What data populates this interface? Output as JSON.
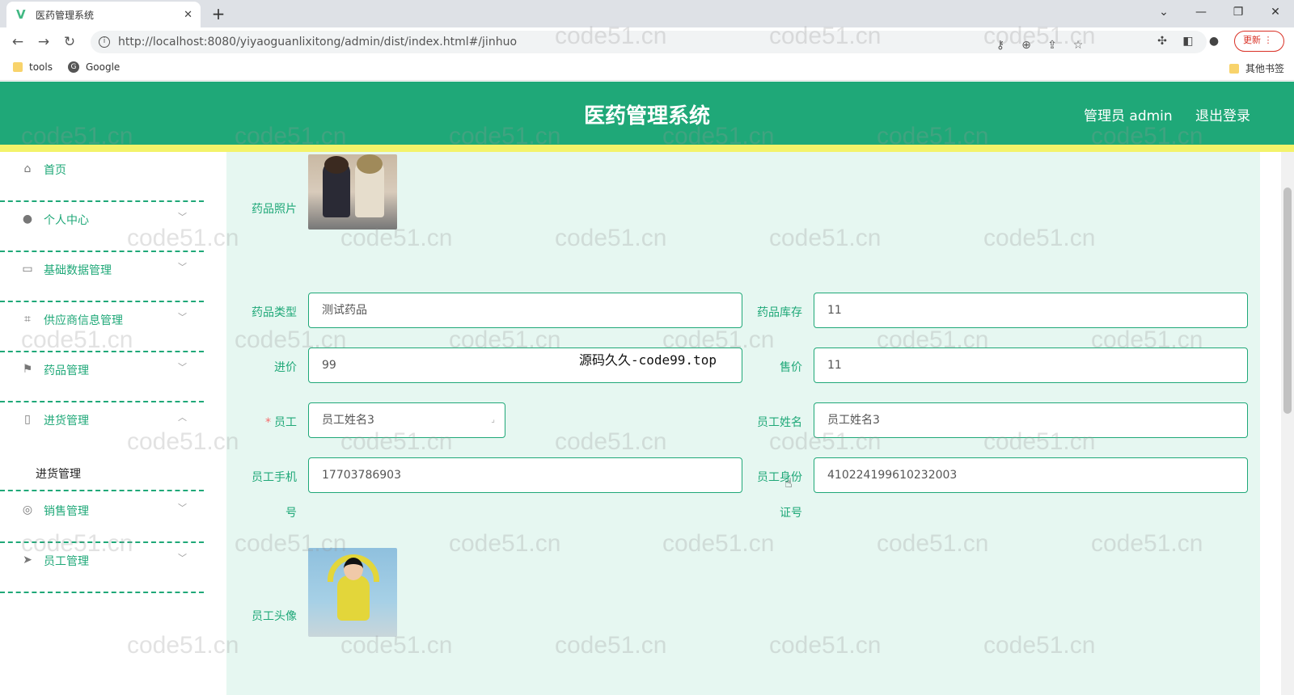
{
  "browser": {
    "tab_title": "医药管理系统",
    "favicon_letter": "V",
    "new_tab": "+",
    "close_tab": "✕",
    "url": "http://localhost:8080/yiyaoguanlixitong/admin/dist/index.html#/jinhuo",
    "update_label": "更新",
    "bookmarks": [
      {
        "label": "tools"
      },
      {
        "label": "Google"
      },
      {
        "label": "其他书签"
      }
    ]
  },
  "header": {
    "title": "医药管理系统",
    "admin_label": "管理员 admin",
    "logout_label": "退出登录",
    "accent": "#1fa878",
    "strip": "#f3f36a"
  },
  "sidebar": {
    "items": [
      {
        "label": "首页",
        "icon": "home-icon"
      },
      {
        "label": "个人中心",
        "icon": "user-icon"
      },
      {
        "label": "基础数据管理",
        "icon": "monitor-icon"
      },
      {
        "label": "供应商信息管理",
        "icon": "crop-icon"
      },
      {
        "label": "药品管理",
        "icon": "flag-icon"
      },
      {
        "label": "进货管理",
        "icon": "phone-icon"
      },
      {
        "label": "销售管理",
        "icon": "circle-icon"
      },
      {
        "label": "员工管理",
        "icon": "send-icon"
      }
    ],
    "submenu_label": "进货管理"
  },
  "form": {
    "drug_photo_label": "药品照片",
    "drug_type_label": "药品类型",
    "drug_type_value": "测试药品",
    "drug_stock_label": "药品库存",
    "drug_stock_value": "11",
    "purchase_price_label": "进价",
    "purchase_price_value": "99",
    "sale_price_label": "售价",
    "sale_price_value": "11",
    "staff_label": "员工",
    "staff_required": "*",
    "staff_select_value": "员工姓名3",
    "staff_name_label": "员工姓名",
    "staff_name_value": "员工姓名3",
    "staff_phone_label_1": "员工手机",
    "staff_phone_label_2": "号",
    "staff_phone_value": "17703786903",
    "staff_id_label_1": "员工身份",
    "staff_id_label_2": "证号",
    "staff_id_value": "410224199610232003",
    "staff_avatar_label": "员工头像"
  },
  "overlay_text": "源码久久-code99.top",
  "watermark": "code51.cn"
}
